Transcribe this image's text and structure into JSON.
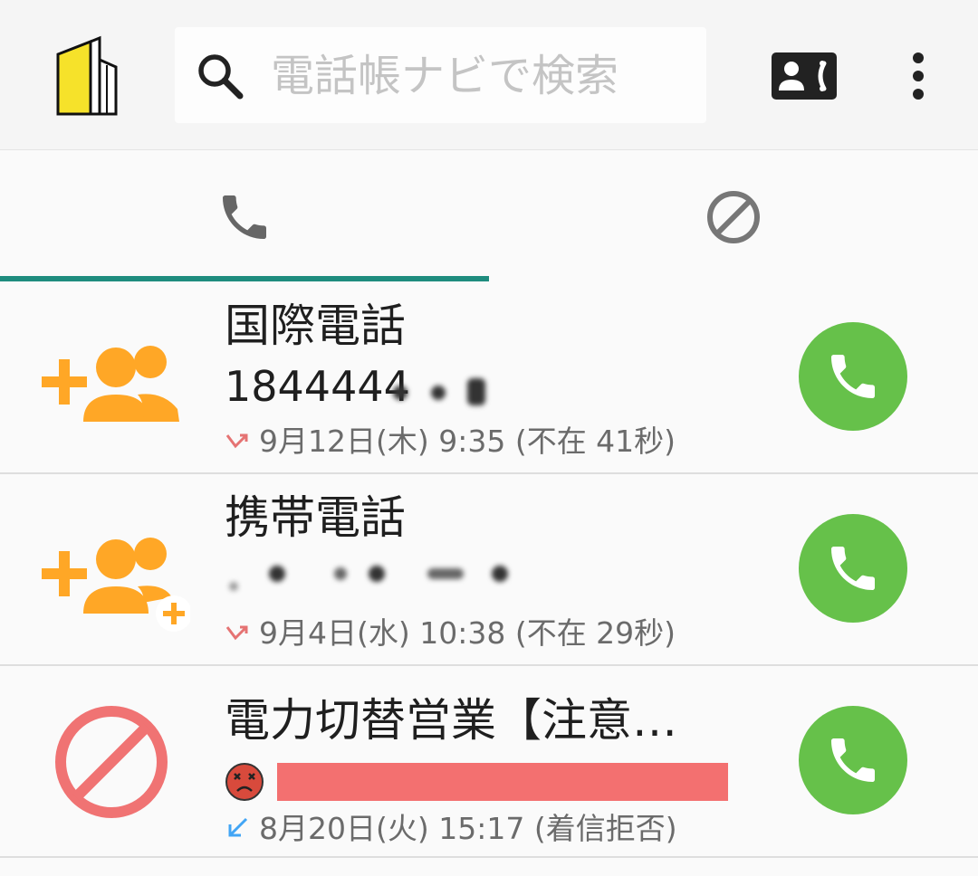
{
  "search": {
    "placeholder": "電話帳ナビで検索"
  },
  "icons": {
    "logo": "building-logo-icon",
    "search": "search-icon",
    "contacts": "contact-phone-icon",
    "more": "more-vert-icon",
    "tab_calls": "phone-icon",
    "tab_blocked": "block-icon",
    "call": "phone-icon",
    "add_contact": "add-group-icon",
    "blocked": "block-icon",
    "missed": "missed-call-icon",
    "incoming": "incoming-call-icon"
  },
  "colors": {
    "accent": "#1e8c7e",
    "call_green": "#66c14a",
    "add_orange": "#ffa726",
    "block_red": "#f07373",
    "missed_red": "#e57373",
    "incoming_blue": "#42a5f5"
  },
  "calls": [
    {
      "name": "国際電話",
      "number": "1844444",
      "meta": "9月12日(木) 9:35 (不在 41秒)",
      "type": "missed"
    },
    {
      "name": "携帯電話",
      "number": "",
      "meta": "9月4日(水) 10:38 (不在 29秒)",
      "type": "missed"
    },
    {
      "name": "電力切替営業【注意…",
      "number": "",
      "meta": "8月20日(火) 15:17 (着信拒否)",
      "type": "incoming-rejected"
    }
  ]
}
